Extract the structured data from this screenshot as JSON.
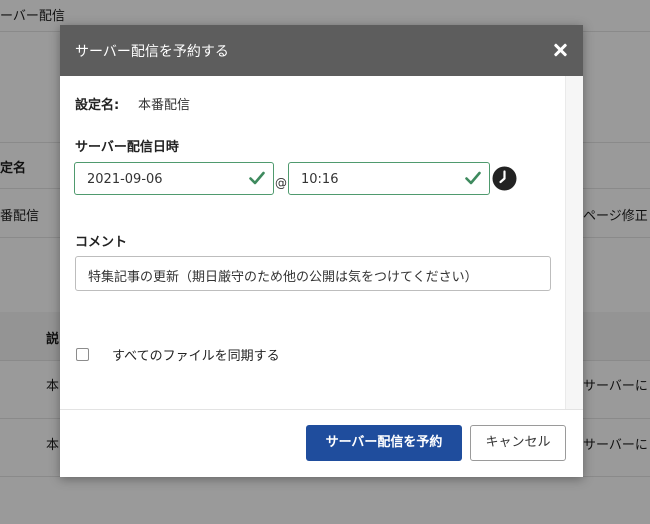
{
  "background": {
    "page_heading": "ーバー配信",
    "col_setting_name": "定名",
    "row1_name": "番配信",
    "row1_right": "ページ修正",
    "col_description": "説",
    "row2_left": "本",
    "row2_right": "サーバーに",
    "row3_left": "本",
    "row3_right": "サーバーに"
  },
  "modal": {
    "title": "サーバー配信を予約する",
    "setting_label": "設定名:",
    "setting_value": "本番配信",
    "datetime_label": "サーバー配信日時",
    "date_value": "2021-09-06",
    "at_symbol": "@",
    "time_value": "10:16",
    "comment_label": "コメント",
    "comment_value": "特集記事の更新（期日厳守のため他の公開は気をつけてください）",
    "sync_label": "すべてのファイルを同期する",
    "sync_checked": false,
    "submit_label": "サーバー配信を予約",
    "cancel_label": "キャンセル"
  },
  "colors": {
    "header_bg": "#5d5d5d",
    "primary_button": "#1f4d9d",
    "valid_green": "#4f9a6e",
    "overlay": "#9a9a9a"
  },
  "icons": [
    "close-icon",
    "check-icon",
    "clock-icon"
  ]
}
